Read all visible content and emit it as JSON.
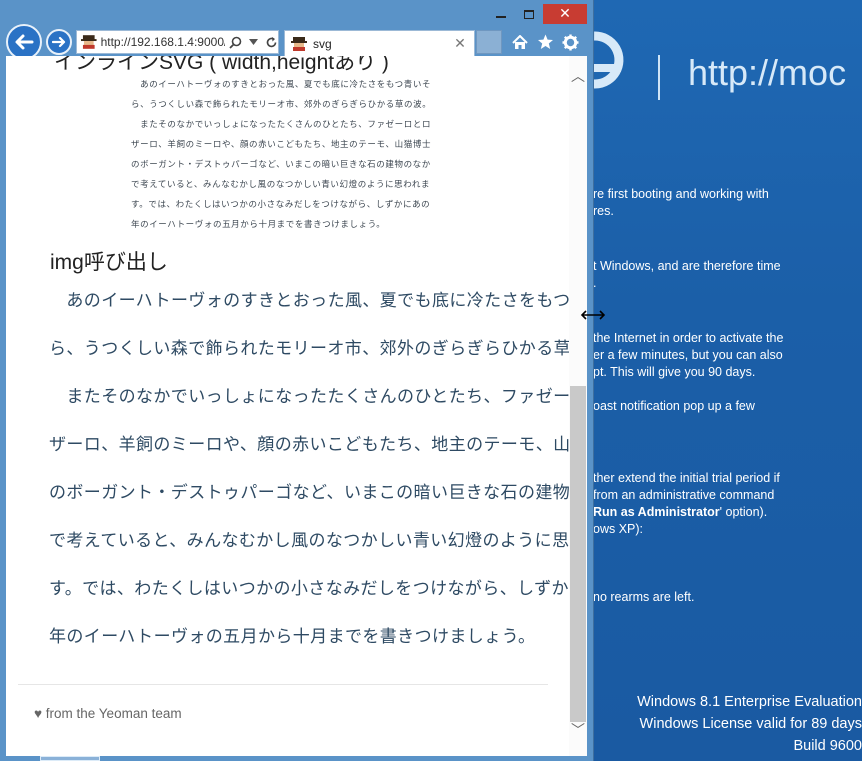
{
  "desktop": {
    "url_text": "http://moc",
    "lines": [
      {
        "text": "re first booting and working with"
      },
      {
        "text": "res."
      },
      {
        "text": "t Windows, and are therefore time"
      },
      {
        "text": "."
      },
      {
        "text": "the Internet in order to activate the"
      },
      {
        "text": "er a few minutes, but you can also"
      },
      {
        "text": "pt. This will give you 90 days."
      },
      {
        "text": "oast notification pop up a few"
      },
      {
        "text": "ther extend the initial trial period if"
      },
      {
        "text": "from an administrative command"
      },
      {
        "text": "' option).",
        "bold_prefix": "Run as Administrator"
      },
      {
        "text": "ows XP):"
      },
      {
        "text": "no rearms are left."
      }
    ],
    "watermark": {
      "edition": "Windows 8.1 Enterprise Evaluation",
      "license": "Windows License valid for 89 days",
      "build": "Build 9600"
    }
  },
  "browser": {
    "window_buttons": {
      "minimize": "",
      "maximize": "",
      "close": "✕"
    },
    "address": "http://192.168.1.4:9000/",
    "tab_label": "svg",
    "tab_close": "✕",
    "page": {
      "cut_heading": "インラインSVG ( width,heightあり )",
      "small_text_lines": [
        "　あのイーハトーヴォのすきとおった風、夏でも底に冷たさをもつ青いそ",
        "ら、うつくしい森で飾られたモリーオ市、郊外のぎらぎらひかる草の波。",
        "　またそのなかでいっしょになったたくさんのひとたち、ファゼーロとロ",
        "ザーロ、羊飼のミーロや、顔の赤いこどもたち、地主のテーモ、山猫博士",
        "のボーガント・デストゥパーゴなど、いまこの暗い巨きな石の建物のなか",
        "で考えていると、みんなむかし風のなつかしい青い幻燈のように思われま",
        "す。では、わたくしはいつかの小さなみだしをつけながら、しずかにあの",
        "年のイーハトーヴォの五月から十月までを書きつけましょう。"
      ],
      "img_heading": "img呼び出し",
      "big_text_lines": [
        "　あのイーハトーヴォのすきとおった風、夏でも底に冷たさをもつ青いそ",
        "ら、うつくしい森で飾られたモリーオ市、郊外のぎらぎらひかる草の波。",
        "　またそのなかでいっしょになったたくさんのひとたち、ファゼーロとロ",
        "ザーロ、羊飼のミーロや、顔の赤いこどもたち、地主のテーモ、山猫博士",
        "のボーガント・デストゥパーゴなど、いまこの暗い巨きな石の建物のなか",
        "で考えていると、みんなむかし風のなつかしい青い幻燈のように思われま",
        "す。では、わたくしはいつかの小さなみだしをつけながら、しずかにあの",
        "年のイーハトーヴォの五月から十月までを書きつけましょう。"
      ],
      "footer": "♥ from the Yeoman team"
    },
    "scrollbar": {
      "up": "︿",
      "down": "﹀"
    },
    "icons": {
      "back": "back-arrow-icon",
      "forward": "forward-arrow-icon",
      "search": "search-icon",
      "dropdown": "chevron-down-icon",
      "refresh": "refresh-icon",
      "home": "home-icon",
      "favorites": "star-icon",
      "tools": "gear-icon",
      "favicon": "yeoman-favicon-icon"
    }
  },
  "colors": {
    "desktop_bg": "#1b5fa8",
    "window_frame": "#5a93c8",
    "close_button": "#c83c32",
    "body_text": "#2e4a63"
  }
}
